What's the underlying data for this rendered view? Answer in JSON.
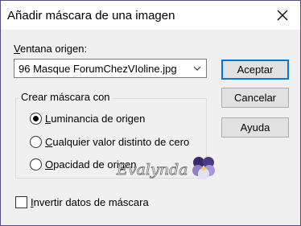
{
  "dialog": {
    "title": "Añadir máscara de una imagen",
    "close_icon": "close-icon"
  },
  "source": {
    "label_prefix": "",
    "label_underlined": "V",
    "label_rest": "entana origen:",
    "selected_value": "96 Masque ForumChezVIoline.jpg"
  },
  "mask_group": {
    "legend": "Crear máscara con",
    "options": [
      {
        "underlined": "L",
        "rest": "uminancia de origen",
        "checked": true
      },
      {
        "underlined": "C",
        "rest": "ualquier valor distinto de cero",
        "checked": false
      },
      {
        "underlined": "O",
        "rest": "pacidad de origen",
        "checked": false
      }
    ]
  },
  "buttons": {
    "accept": "Aceptar",
    "cancel": "Cancelar",
    "help": "Ayuda"
  },
  "invert": {
    "underlined": "I",
    "rest": "nvertir datos de máscara",
    "checked": false
  },
  "watermark": {
    "text": "Evalynda",
    "icon": "pansy-flower-icon"
  },
  "colors": {
    "accent": "#0078d7",
    "window_border": "#5a4a8a",
    "content_bg": "#f0f0f0"
  }
}
